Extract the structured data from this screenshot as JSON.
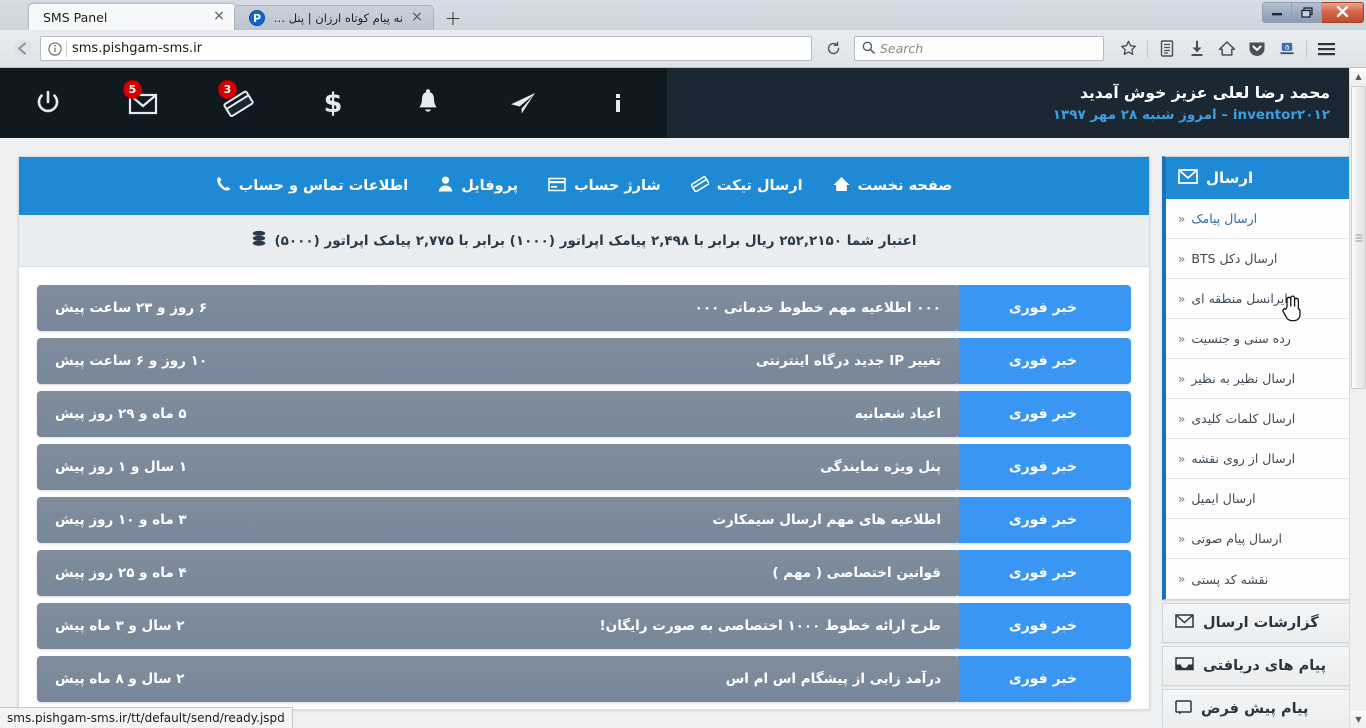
{
  "browser": {
    "tabs": [
      {
        "title": "SMS Panel",
        "active": true,
        "favicon": "none",
        "close_label": "×"
      },
      {
        "title": "نه پیام کوتاه ارزان | پنل اس ام اس",
        "active": false,
        "favicon": "P",
        "close_label": "×"
      }
    ],
    "new_tab_label": "+",
    "window_controls": {
      "minimize": "–",
      "maximize": "❐",
      "close": "✕"
    },
    "nav": {
      "back_label": "←",
      "info_label": "ⓘ",
      "url": "sms.pishgam-sms.ir",
      "reload_label": "⟳"
    },
    "search": {
      "placeholder": "Search",
      "icon": "search-icon"
    },
    "toolbar_icons": [
      "bookmark-star-icon",
      "library-icon",
      "downloads-icon",
      "home-icon",
      "pocket-icon",
      "account-icon",
      "hamburger-menu-icon"
    ],
    "status_url": "sms.pishgam-sms.ir/tt/default/send/ready.jspd"
  },
  "header": {
    "welcome": "محمد رضا لعلی عزیز خوش آمدید",
    "subtitle": "inventor۲۰۱۲ – امروز شنبه ۲۸ مهر ۱۳۹۷",
    "icons": [
      {
        "name": "power-icon",
        "badge": null
      },
      {
        "name": "envelope-icon",
        "badge": "5"
      },
      {
        "name": "tickets-icon",
        "badge": "3"
      },
      {
        "name": "dollar-icon",
        "badge": null
      },
      {
        "name": "bell-icon",
        "badge": null
      },
      {
        "name": "send-plane-icon",
        "badge": null
      },
      {
        "name": "info-icon",
        "badge": null
      }
    ],
    "accent_blue": "#3c9ee0",
    "bg_dark": "#101820"
  },
  "topnav": {
    "items": [
      {
        "label": "صفحه نخست",
        "icon": "home-icon"
      },
      {
        "label": "ارسال تیکت",
        "icon": "ticket-icon"
      },
      {
        "label": "شارژ حساب",
        "icon": "card-icon"
      },
      {
        "label": "پروفایل",
        "icon": "user-icon"
      },
      {
        "label": "اطلاعات تماس و حساب",
        "icon": "phone-icon"
      }
    ],
    "bg": "#1e8ad6"
  },
  "credit": {
    "icon": "stack-icon",
    "text": "اعتبار شما ۲۵۲,۲۱۵۰ ریال برابر با ۲,۴۹۸ پیامک اپراتور (۱۰۰۰) برابر با ۲,۷۷۵ پیامک اپراتور (۵۰۰۰)"
  },
  "news": {
    "tag_label": "خبر فوری",
    "rows": [
      {
        "title": "۰۰۰ اطلاعیه مهم خطوط خدماتی ۰۰۰",
        "time": "۶ روز و ۲۳ ساعت پیش"
      },
      {
        "title": "تغییر IP جدید درگاه اینترنتی",
        "time": "۱۰ روز و ۶ ساعت پیش"
      },
      {
        "title": "اعیاد شعبانیه",
        "time": "۵ ماه و ۲۹ روز پیش"
      },
      {
        "title": "پنل ویژه نمایندگی",
        "time": "۱ سال و ۱ روز پیش"
      },
      {
        "title": "اطلاعیه های مهم ارسال سیمکارت",
        "time": "۳ ماه و ۱۰ روز پیش"
      },
      {
        "title": "قوانین اختصاصی ( مهم )",
        "time": "۴ ماه و ۲۵ روز پیش"
      },
      {
        "title": "طرح ارائه خطوط ۱۰۰۰ اختصاصی به صورت رایگان!",
        "time": "۲ سال و ۳ ماه پیش"
      },
      {
        "title": "درآمد زایی از پیشگام اس ام اس",
        "time": "۲ سال و ۸ ماه پیش"
      }
    ],
    "tag_color": "#3a96f3",
    "row_color": "#7b8a99"
  },
  "sidebar": {
    "panel_title": "ارسال",
    "panel_icon": "envelope-icon",
    "items": [
      {
        "label": "ارسال پیامک",
        "active": true
      },
      {
        "label": "ارسال دکل BTS",
        "active": false
      },
      {
        "label": "ایرانسل منطقه ای",
        "active": false
      },
      {
        "label": "رده سنی و جنسیت",
        "active": false
      },
      {
        "label": "ارسال نظیر به نظیر",
        "active": false
      },
      {
        "label": "ارسال کلمات کلیدی",
        "active": false
      },
      {
        "label": "ارسال از روی نقشه",
        "active": false
      },
      {
        "label": "ارسال ایمیل",
        "active": false
      },
      {
        "label": "ارسال پیام صوتی",
        "active": false
      },
      {
        "label": "نقشه کد پستی",
        "active": false
      }
    ],
    "chevron": "«",
    "blocks": [
      {
        "label": "گزارشات ارسال",
        "icon": "envelope-icon"
      },
      {
        "label": "پیام های دریافتی",
        "icon": "inbox-icon"
      },
      {
        "label": "پیام پیش فرض",
        "icon": "message-icon"
      }
    ]
  }
}
